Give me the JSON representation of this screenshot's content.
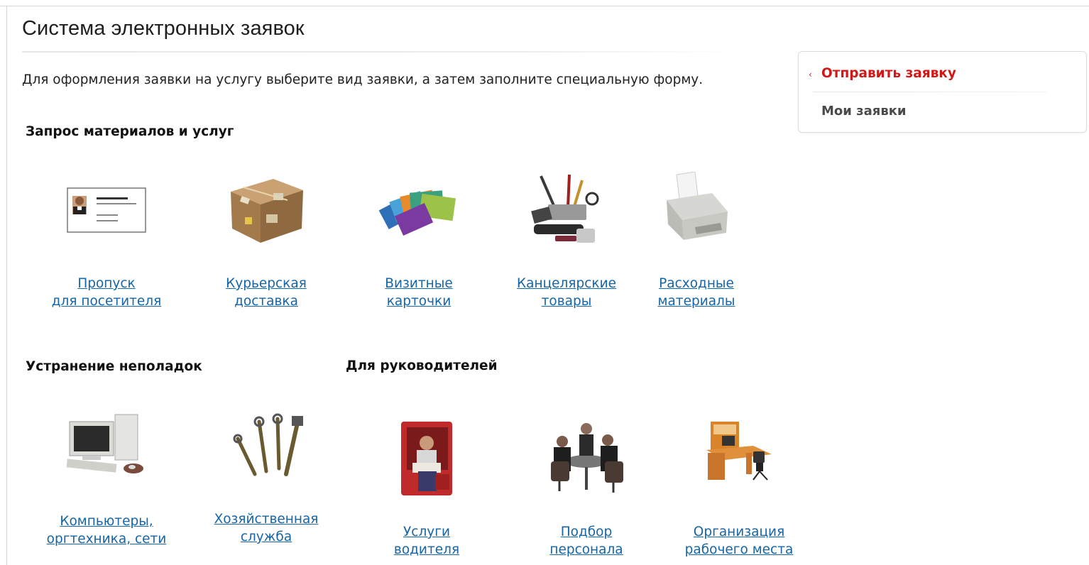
{
  "page": {
    "title": "Система электронных заявок",
    "intro": "Для оформления заявки на услугу выберите вид заявки, а затем заполните специальную форму."
  },
  "sections": {
    "materials": "Запрос материалов и услуг",
    "repair": "Устранение неполадок",
    "managers": "Для руководителей"
  },
  "tiles": {
    "visitor_pass": {
      "line1": "Пропуск",
      "line2": "для посетителя",
      "icon": "business-card-icon"
    },
    "courier": {
      "line1": "Курьерская",
      "line2": "доставка",
      "icon": "parcel-icon"
    },
    "business_cards": {
      "line1": "Визитные",
      "line2": "карточки",
      "icon": "cards-icon"
    },
    "stationery": {
      "line1": "Канцелярские",
      "line2": "товары",
      "icon": "stationery-icon"
    },
    "consumables": {
      "line1": "Расходные",
      "line2": "материалы",
      "icon": "printer-icon"
    },
    "computers": {
      "line1": "Компьютеры,",
      "line2": "оргтехника, сети",
      "icon": "computer-icon"
    },
    "maintenance": {
      "line1": "Хозяйственная",
      "line2": "служба",
      "icon": "wrenches-icon"
    },
    "driver": {
      "line1": "Услуги",
      "line2": "водителя",
      "icon": "driver-icon"
    },
    "recruiting": {
      "line1": "Подбор",
      "line2": "персонала",
      "icon": "meeting-icon"
    },
    "workplace": {
      "line1": "Организация",
      "line2": "рабочего места",
      "icon": "desk-icon"
    }
  },
  "sidebar": {
    "items": [
      {
        "label": "Отправить заявку",
        "active": true
      },
      {
        "label": "Мои заявки",
        "active": false
      }
    ]
  },
  "colors": {
    "link": "#1565a8",
    "active": "#d01818"
  }
}
